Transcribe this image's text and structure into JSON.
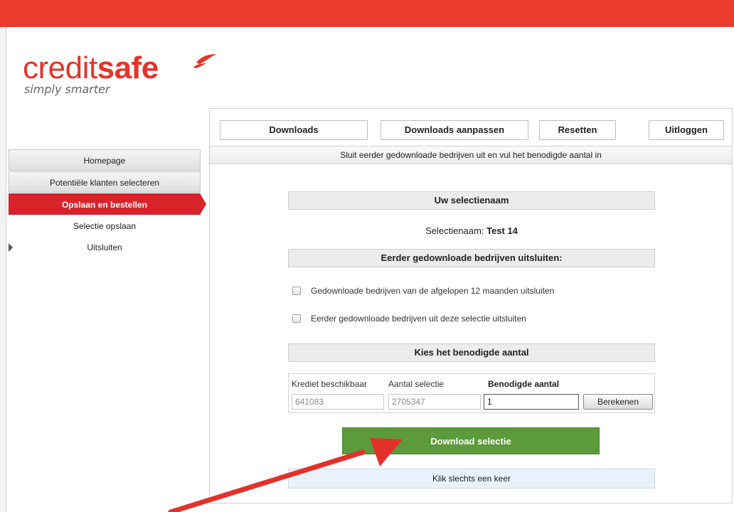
{
  "colors": {
    "brand": "#ee3b2f",
    "active": "#d9232b",
    "download": "#5c9a3b",
    "arrow": "#e4302b"
  },
  "logo": {
    "word_light": "credit",
    "word_bold": "safe",
    "tagline": "simply smarter"
  },
  "nav": {
    "downloads": "Downloads",
    "downloads_edit": "Downloads aanpassen",
    "reset": "Resetten",
    "logout": "Uitloggen"
  },
  "sidebar": {
    "items": [
      {
        "label": "Homepage"
      },
      {
        "label": "Potentiële klanten selecteren"
      },
      {
        "label": "Opslaan en bestellen"
      }
    ],
    "sub_items": [
      {
        "label": "Selectie opslaan"
      },
      {
        "label": "Uitsluiten"
      }
    ]
  },
  "info_bar": "Sluit eerder gedownloade bedrijven uit en vul het benodigde aantal in",
  "selection": {
    "header": "Uw selectienaam",
    "name_label": "Selectienaam:",
    "name_value": "Test 14"
  },
  "exclude": {
    "header": "Eerder gedownloade bedrijven uitsluiten:",
    "option1": "Gedownloade bedrijven van de afgelopen 12 maanden uitsluiten",
    "option2": "Eerder gedownloade bedrijven uit deze selectie uitsluiten"
  },
  "amount": {
    "header": "Kies het benodigde aantal",
    "credit_label": "Krediet beschikbaar",
    "credit_value": "641083",
    "selection_label": "Aantal selectie",
    "selection_value": "2705347",
    "required_label": "Benodigde aantal",
    "required_value": "1",
    "calculate": "Berekenen"
  },
  "download": {
    "button": "Download selectie",
    "note": "Klik slechts een keer"
  }
}
